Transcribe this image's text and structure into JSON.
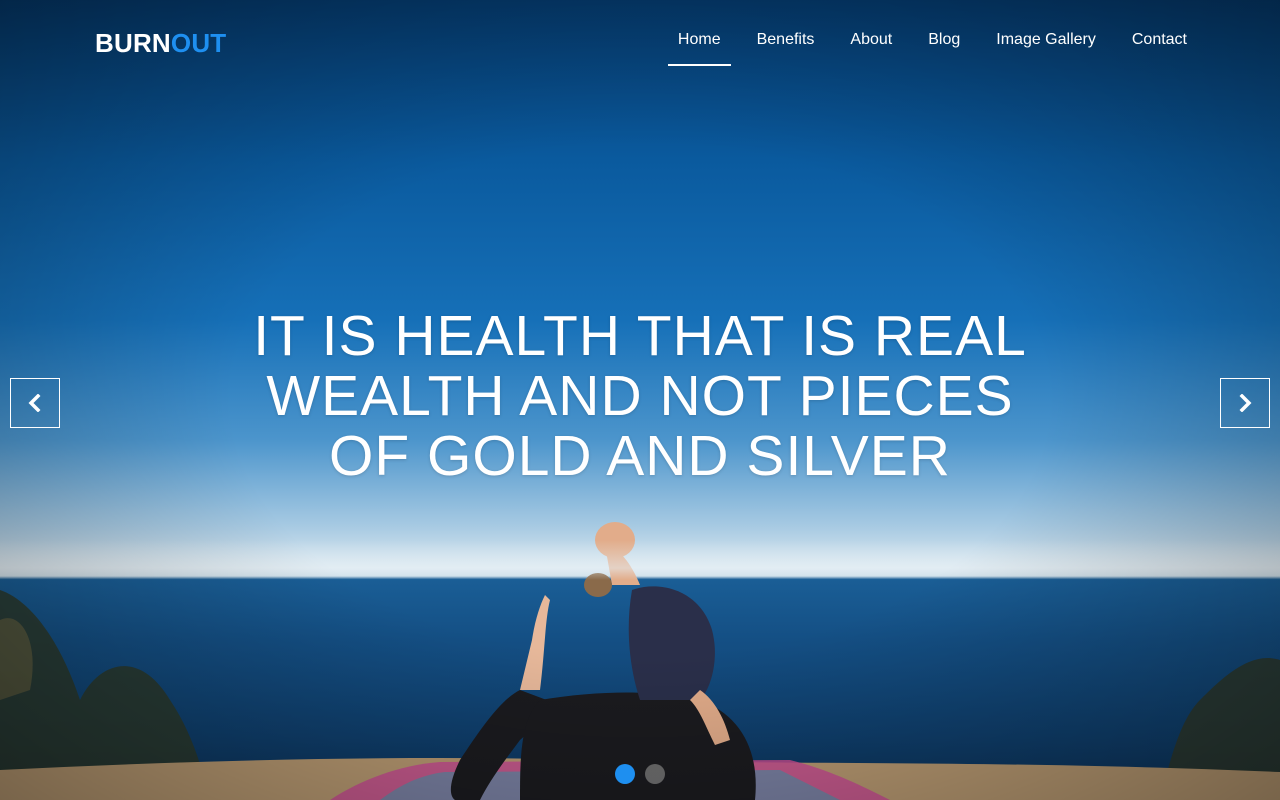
{
  "brand": {
    "part1": "BURN",
    "part2": "OUT"
  },
  "nav": {
    "items": [
      {
        "label": "Home",
        "active": true
      },
      {
        "label": "Benefits"
      },
      {
        "label": "About"
      },
      {
        "label": "Blog"
      },
      {
        "label": "Image Gallery"
      },
      {
        "label": "Contact"
      }
    ]
  },
  "hero": {
    "headline_lines": [
      "IT IS HEALTH THAT IS REAL",
      "WEALTH AND NOT PIECES",
      "OF GOLD AND SILVER"
    ],
    "prev_icon": "chevron-left-icon",
    "next_icon": "chevron-right-icon",
    "slide_count": 2,
    "active_slide": 1
  },
  "colors": {
    "accent": "#1e8ff0",
    "text": "#ffffff",
    "inactive_dot": "#7a7a7a"
  }
}
